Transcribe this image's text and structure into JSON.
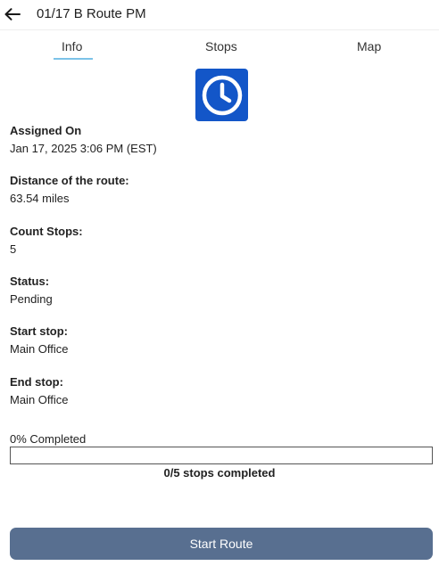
{
  "header": {
    "back_icon": "arrow-left-icon",
    "title": "01/17 B Route PM"
  },
  "tabs": [
    {
      "label": "Info",
      "active": true
    },
    {
      "label": "Stops",
      "active": false
    },
    {
      "label": "Map",
      "active": false
    }
  ],
  "route_icon": {
    "name": "clock-icon",
    "color": "#1356c8"
  },
  "fields": {
    "assigned": {
      "label": "Assigned On",
      "value": "Jan 17, 2025 3:06 PM  (EST)"
    },
    "distance": {
      "label": "Distance of the route:",
      "value": "63.54 miles"
    },
    "count": {
      "label": "Count Stops:",
      "value": "5"
    },
    "status": {
      "label": "Status:",
      "value": "Pending"
    },
    "start": {
      "label": "Start stop:",
      "value": "Main Office"
    },
    "end": {
      "label": "End stop:",
      "value": "Main Office"
    }
  },
  "progress": {
    "label": "0% Completed",
    "fraction": 0,
    "caption": "0/5 stops completed"
  },
  "actions": {
    "start_label": "Start Route",
    "start_color": "#586f90"
  }
}
